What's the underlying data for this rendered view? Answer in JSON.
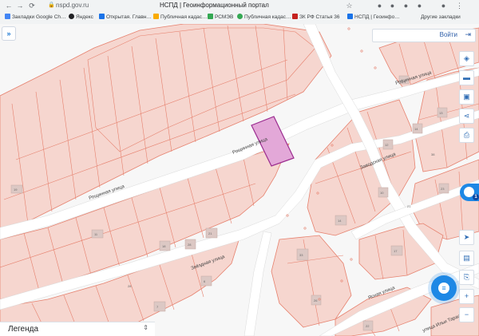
{
  "browser": {
    "url": "nspd.gov.ru",
    "page_title": "НСПД | Геоинформационный портал",
    "bookmarks": [
      "Закладки Google Ch…",
      "Яндекс",
      "Открытая. Главн…",
      "Публичная кадас…",
      "РСМЭВ",
      "Публичная кадас…",
      "ЗК РФ Статья 36",
      "НСПД | Геоинфо…"
    ],
    "other_bookmarks": "Другие закладки",
    "bookmark_colors": [
      "#4285f4",
      "#202124",
      "#1a73e8",
      "#f9ab00",
      "#34a853",
      "#34a853",
      "#c5221f",
      "#1a73e8"
    ]
  },
  "map": {
    "login_label": "Войти",
    "expand_icon": "double-chevron-right-icon",
    "legend_label": "Легенда",
    "street_labels": [
      "Рощинная улица",
      "Рощинная улица",
      "Рощинная улица",
      "Заводская улица",
      "Звёздная улица",
      "Ясная улица",
      "улица Ильи Тарасова"
    ],
    "parcel_numbers": [
      "19",
      "11",
      "18",
      "28",
      "21",
      "7",
      "6",
      "33",
      "14",
      "10",
      "12",
      "14",
      "13",
      "23",
      "17",
      "22",
      "26",
      "4",
      "28",
      "21",
      "38"
    ],
    "colors": {
      "parcel_fill": "#f6d6cf",
      "parcel_stroke": "#e6816e",
      "selected_fill": "#e3a8d8",
      "selected_stroke": "#9b2b8f",
      "road": "#ffffff",
      "building": "#dcc8c4",
      "accent": "#1e88e5"
    }
  },
  "toolbar": {
    "items": [
      "layers-icon",
      "ruler-icon",
      "image-icon",
      "share-icon",
      "print-icon"
    ],
    "bottom_items": [
      "navigate-icon",
      "layer-icon",
      "copy-icon",
      "zoom-in-icon",
      "zoom-out-icon"
    ],
    "zoom_in": "+",
    "zoom_out": "−",
    "notification_badge": "1"
  }
}
